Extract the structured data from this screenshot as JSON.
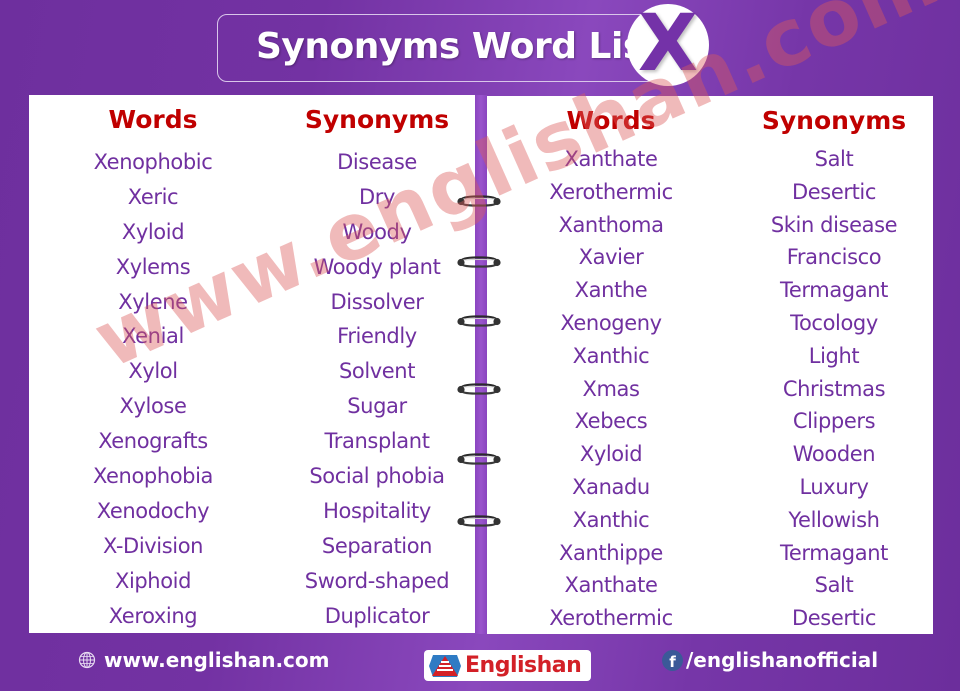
{
  "title": {
    "text": "Synonyms Word List",
    "letter": "X"
  },
  "colors": {
    "background": "#7332a3",
    "header_red": "#c00000",
    "item_purple": "#7030a0",
    "watermark": "#dc5a5a",
    "logo_red": "#d32027",
    "facebook_blue": "#3b5998"
  },
  "left_panel": {
    "words_header": "Words",
    "synonyms_header": "Synonyms",
    "rows": [
      {
        "word": "Xenophobic",
        "synonym": "Disease"
      },
      {
        "word": "Xeric",
        "synonym": "Dry"
      },
      {
        "word": "Xyloid",
        "synonym": "Woody"
      },
      {
        "word": "Xylems",
        "synonym": "Woody plant"
      },
      {
        "word": "Xylene",
        "synonym": "Dissolver"
      },
      {
        "word": "Xenial",
        "synonym": "Friendly"
      },
      {
        "word": "Xylol",
        "synonym": "Solvent"
      },
      {
        "word": "Xylose",
        "synonym": "Sugar"
      },
      {
        "word": "Xenografts",
        "synonym": "Transplant"
      },
      {
        "word": "Xenophobia",
        "synonym": "Social phobia"
      },
      {
        "word": "Xenodochy",
        "synonym": "Hospitality"
      },
      {
        "word": "X-Division",
        "synonym": "Separation"
      },
      {
        "word": "Xiphoid",
        "synonym": "Sword-shaped"
      },
      {
        "word": "Xeroxing",
        "synonym": "Duplicator"
      }
    ]
  },
  "right_panel": {
    "words_header": "Words",
    "synonyms_header": "Synonyms",
    "rows": [
      {
        "word": "Xanthate",
        "synonym": "Salt"
      },
      {
        "word": "Xerothermic",
        "synonym": "Desertic"
      },
      {
        "word": "Xanthoma",
        "synonym": "Skin disease"
      },
      {
        "word": "Xavier",
        "synonym": "Francisco"
      },
      {
        "word": "Xanthe",
        "synonym": "Termagant"
      },
      {
        "word": "Xenogeny",
        "synonym": "Tocology"
      },
      {
        "word": "Xanthic",
        "synonym": "Light"
      },
      {
        "word": "Xmas",
        "synonym": "Christmas"
      },
      {
        "word": "Xebecs",
        "synonym": "Clippers"
      },
      {
        "word": "Xyloid",
        "synonym": "Wooden"
      },
      {
        "word": "Xanadu",
        "synonym": "Luxury"
      },
      {
        "word": "Xanthic",
        "synonym": "Yellowish"
      },
      {
        "word": "Xanthippe",
        "synonym": "Termagant"
      },
      {
        "word": "Xanthate",
        "synonym": "Salt"
      },
      {
        "word": "Xerothermic",
        "synonym": "Desertic"
      }
    ]
  },
  "watermark": "www.englishan.com",
  "footer": {
    "website_icon": "globe-icon",
    "website": "www.englishan.com",
    "logo_text": "Englishan",
    "facebook_icon": "facebook-icon",
    "facebook_glyph": "f",
    "facebook_handle": "/englishanofficial"
  }
}
